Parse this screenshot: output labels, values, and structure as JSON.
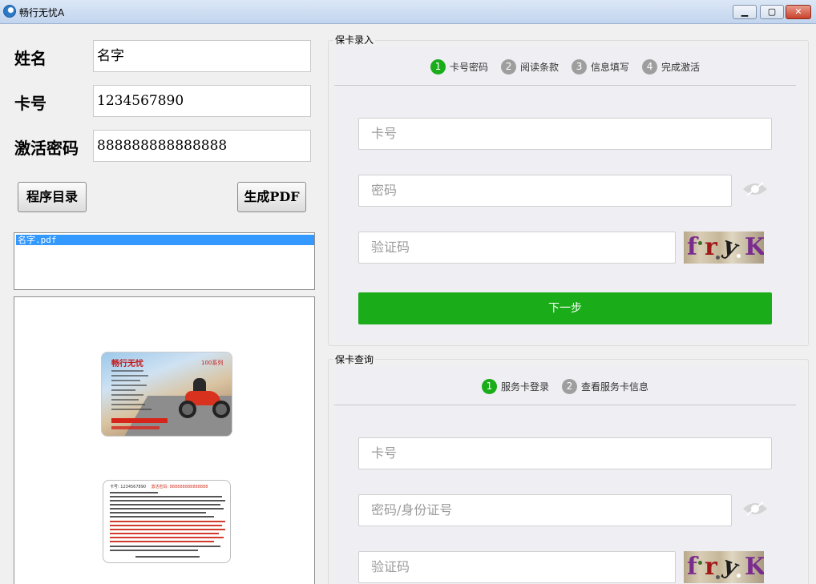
{
  "window": {
    "title": "畅行无忧A",
    "minimize_glyph": "▁",
    "maximize_glyph": "▢",
    "close_glyph": "✕"
  },
  "form": {
    "name_label": "姓名",
    "name_value": "名字",
    "card_label": "卡号",
    "card_value": "1234567890",
    "password_label": "激活密码",
    "password_value": "888888888888888"
  },
  "buttons": {
    "program_dir": "程序目录",
    "generate_pdf": "生成PDF"
  },
  "file_list": {
    "items": [
      "名字.pdf"
    ],
    "selected_index": 0
  },
  "preview": {
    "card_front_brand": "畅行无忧",
    "card_front_series": "100系列",
    "card_back_card_label": "卡号: 1234567890",
    "card_back_password_label": "激活密码: 888888888888888"
  },
  "card_entry": {
    "group_title": "保卡录入",
    "steps": [
      {
        "num": "1",
        "label": "卡号密码",
        "active": true
      },
      {
        "num": "2",
        "label": "阅读条款",
        "active": false
      },
      {
        "num": "3",
        "label": "信息填写",
        "active": false
      },
      {
        "num": "4",
        "label": "完成激活",
        "active": false
      }
    ],
    "card_placeholder": "卡号",
    "password_placeholder": "密码",
    "captcha_placeholder": "验证码",
    "captcha_chars": [
      "f",
      "r",
      "y",
      "K"
    ],
    "next_button": "下一步"
  },
  "card_query": {
    "group_title": "保卡查询",
    "steps": [
      {
        "num": "1",
        "label": "服务卡登录",
        "active": true
      },
      {
        "num": "2",
        "label": "查看服务卡信息",
        "active": false
      }
    ],
    "card_placeholder": "卡号",
    "password_placeholder": "密码/身份证号",
    "captcha_placeholder": "验证码",
    "captcha_chars": [
      "f",
      "r",
      "y",
      "K"
    ]
  },
  "colors": {
    "accent_green": "#1aad19",
    "step_inactive": "#9e9e9e",
    "selection_blue": "#3399ff"
  }
}
